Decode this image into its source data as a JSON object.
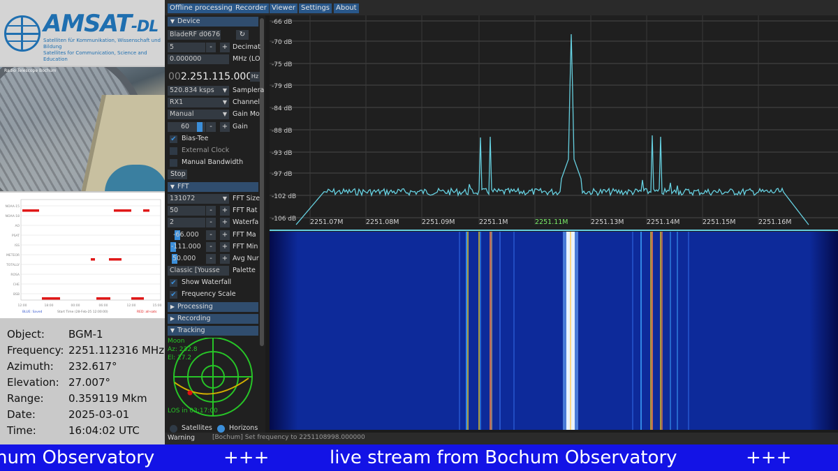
{
  "logo": {
    "brand": "AMSAT",
    "brand_suffix": "-DL",
    "tagline": "Satelliten für Kommunikation, Wissenschaft und Bildung\nSatellites for Communication, Science and Education"
  },
  "info": {
    "rows": [
      {
        "label": "Object:",
        "value": "BGM-1"
      },
      {
        "label": "Frequency:",
        "value": "2251.112316 MHz"
      },
      {
        "label": "Azimuth:",
        "value": "232.617°"
      },
      {
        "label": "Elevation:",
        "value": "27.007°"
      },
      {
        "label": "Range:",
        "value": "0.359119 Mkm"
      },
      {
        "label": "Date:",
        "value": "2025-03-01"
      },
      {
        "label": "Time:",
        "value": "16:04:02 UTC"
      }
    ]
  },
  "menu": {
    "items": [
      "Offline processing",
      "Recorder",
      "Viewer",
      "Settings",
      "About"
    ]
  },
  "sidebar": {
    "device_header": "Device",
    "device_name": "BladeRF d0676",
    "decimation_value": "5",
    "decimation_label": "Decimat",
    "lo_value": "0.000000",
    "lo_label": "MHz (LO",
    "freq_prefix": "00",
    "freq_main": "2.251.115.000",
    "freq_unit": "Hz",
    "samplerate_value": "520.834 ksps",
    "samplerate_label": "Samplera",
    "channel_value": "RX1",
    "channel_label": "Channel",
    "gain_mode_value": "Manual",
    "gain_mode_label": "Gain Mo",
    "gain_value": "60",
    "gain_label": "Gain",
    "bias_tee": "Bias-Tee",
    "external_clock": "External Clock",
    "manual_bandwidth": "Manual Bandwidth",
    "stop_label": "Stop",
    "fft_header": "FFT",
    "fft_size_value": "131072",
    "fft_size_label": "FFT Size",
    "fft_rate_value": "50",
    "fft_rate_label": "FFT Rat",
    "waterfall_value": "2",
    "waterfall_label": "Waterfa",
    "fft_max_value": "-66.000",
    "fft_max_label": "FFT Ma",
    "fft_min_value": "-111.000",
    "fft_min_label": "FFT Min",
    "avg_value": "50.000",
    "avg_label": "Avg Nur",
    "palette_value": "Classic [Yousse",
    "palette_label": "Palette",
    "show_waterfall": "Show Waterfall",
    "frequency_scale": "Frequency Scale",
    "processing_header": "Processing",
    "recording_header": "Recording",
    "tracking_header": "Tracking",
    "tracking_target": "Moon",
    "tracking_az": "Az: 232.8",
    "tracking_el": "El: 27.2",
    "tracking_los": "LOS in 03:17:00",
    "satellites_label": "Satellites",
    "horizons_label": "Horizons"
  },
  "status": {
    "level": "Warning",
    "message": "[Bochum] Set frequency to 2251108998.000000"
  },
  "spectrum": {
    "db_labels": [
      "-66 dB",
      "-70 dB",
      "-75 dB",
      "-79 dB",
      "-84 dB",
      "-88 dB",
      "-93 dB",
      "-97 dB",
      "-102 dB",
      "-106 dB"
    ],
    "freq_labels": [
      "2251.07M",
      "2251.08M",
      "2251.09M",
      "2251.1M",
      "2251.11M",
      "2251.13M",
      "2251.14M",
      "2251.15M",
      "2251.16M"
    ],
    "highlight_freq": "2251.11M",
    "trace_color": "#66d0e0",
    "highlight_color": "#7cf06a"
  },
  "schedule": {
    "rows": [
      "NOAA-15",
      "NOAA-18",
      "AO",
      "PSAT",
      "ISS",
      "METEOR",
      "TOTALLY",
      "ROSA",
      "CHE",
      "BSB"
    ],
    "times": [
      "12:00",
      "18:00",
      "00:00",
      "06:00",
      "12:00",
      "15:00"
    ],
    "footer_left": "BLUE: Saved",
    "footer_mid": "Start Time (28-Feb-25 12:00:00)",
    "footer_right": "RED: all-sats"
  },
  "camera": {
    "overlay": "Radio Telescope Bochum"
  },
  "ticker": {
    "left": "hum Observatory",
    "sep1": "+++",
    "middle": "live stream from Bochum Observatory",
    "sep2": "+++"
  }
}
